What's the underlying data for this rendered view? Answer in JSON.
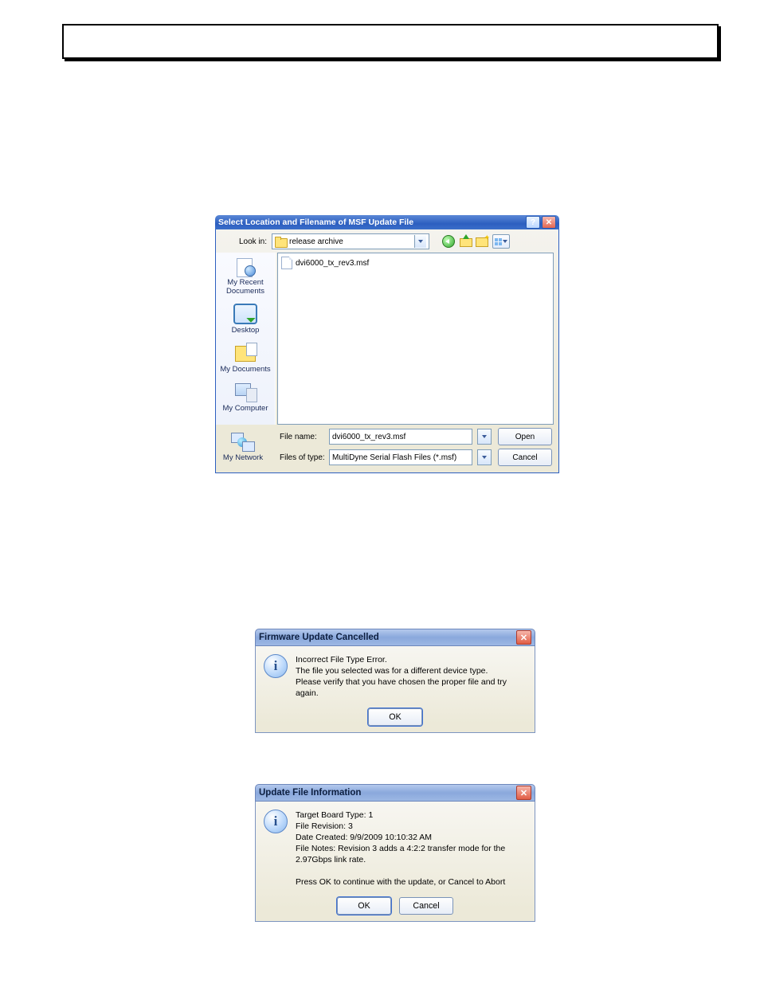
{
  "fileDialog": {
    "title": "Select Location and Filename of MSF Update File",
    "lookInLabel": "Look in:",
    "lookInValue": "release archive",
    "fileListed": "dvi6000_tx_rev3.msf",
    "fileNameLabel": "File name:",
    "fileNameValue": "dvi6000_tx_rev3.msf",
    "fileTypeLabel": "Files of type:",
    "fileTypeValue": "MultiDyne Serial Flash Files (*.msf)",
    "openLabel": "Open",
    "cancelLabel": "Cancel",
    "helpGlyph": "?",
    "closeGlyph": "✕",
    "places": {
      "recent": "My Recent\nDocuments",
      "desktop": "Desktop",
      "documents": "My Documents",
      "computer": "My Computer",
      "network": "My Network"
    }
  },
  "cancelMsg": {
    "title": "Firmware Update Cancelled",
    "text": "Incorrect File Type Error.\nThe file you selected was for a different device type.\nPlease verify that you have chosen the proper file and try again.",
    "ok": "OK",
    "closeGlyph": "✕"
  },
  "infoMsg": {
    "title": "Update File Information",
    "text": "Target Board Type: 1\nFile Revision: 3\nDate Created: 9/9/2009 10:10:32 AM\nFile Notes: Revision 3 adds a 4:2:2 transfer mode for the 2.97Gbps link rate.\n\nPress OK to continue with the update, or Cancel to Abort",
    "ok": "OK",
    "cancel": "Cancel",
    "closeGlyph": "✕"
  }
}
